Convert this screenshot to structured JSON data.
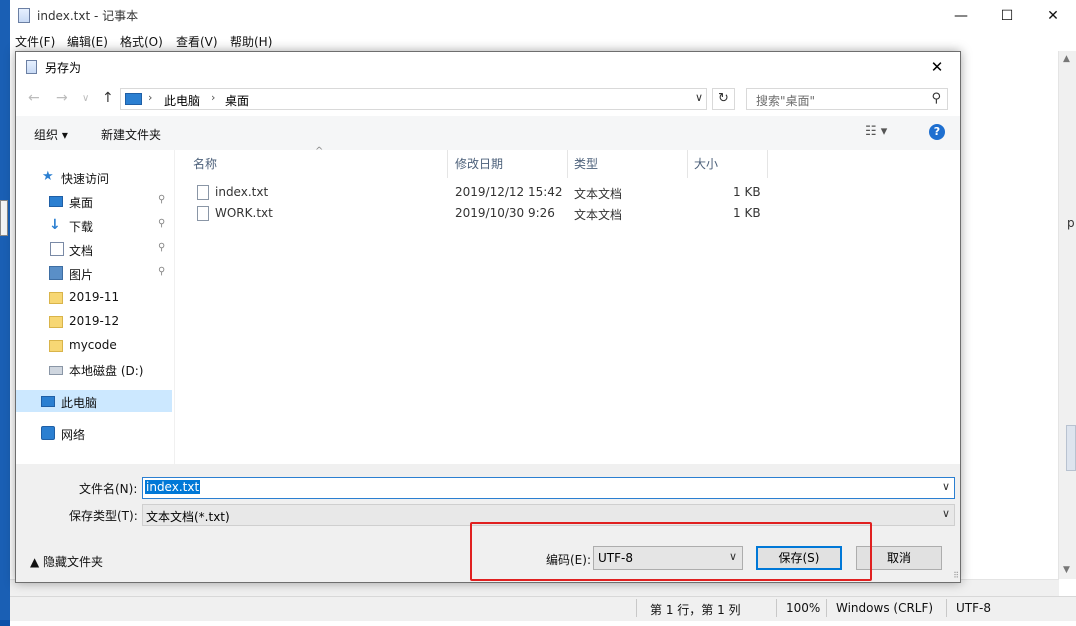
{
  "notepad": {
    "title": "index.txt - 记事本",
    "controls": {
      "minimize": "—",
      "maximize": "☐",
      "close": "✕"
    },
    "menu": [
      "文件(F)",
      "编辑(E)",
      "格式(O)",
      "查看(V)",
      "帮助(H)"
    ],
    "status": {
      "position": "第 1 行，第 1 列",
      "zoom": "100%",
      "line_ending": "Windows (CRLF)",
      "encoding": "UTF-8"
    },
    "peek_text": "p"
  },
  "dialog": {
    "title": "另存为",
    "close": "✕",
    "nav": {
      "back": "←",
      "forward": "→",
      "recent": "∨",
      "up": "↑"
    },
    "breadcrumb": [
      "此电脑",
      "桌面"
    ],
    "breadcrumb_sep": "›",
    "refresh": "↻",
    "search_placeholder": "搜索\"桌面\"",
    "toolbar": {
      "organize": "组织 ▾",
      "new_folder": "新建文件夹",
      "view": "☷ ▾",
      "help": "?"
    },
    "sidebar": [
      {
        "label": "快速访问",
        "icon": "star-icon"
      },
      {
        "label": "桌面",
        "icon": "desktop-icon",
        "pin": "📌"
      },
      {
        "label": "下载",
        "icon": "download-icon",
        "pin": "📌"
      },
      {
        "label": "文档",
        "icon": "document-icon",
        "pin": "📌"
      },
      {
        "label": "图片",
        "icon": "picture-icon",
        "pin": "📌"
      },
      {
        "label": "2019-11",
        "icon": "folder-icon"
      },
      {
        "label": "2019-12",
        "icon": "folder-icon"
      },
      {
        "label": "mycode",
        "icon": "folder-icon"
      },
      {
        "label": "本地磁盘 (D:)",
        "icon": "drive-icon"
      },
      {
        "label": "此电脑",
        "icon": "computer-icon",
        "selected": true
      },
      {
        "label": "网络",
        "icon": "network-icon"
      }
    ],
    "columns": [
      "名称",
      "修改日期",
      "类型",
      "大小"
    ],
    "sort_indicator": "^",
    "files": [
      {
        "name": "index.txt",
        "date": "2019/12/12 15:42",
        "type": "文本文档",
        "size": "1 KB"
      },
      {
        "name": "WORK.txt",
        "date": "2019/10/30 9:26",
        "type": "文本文档",
        "size": "1 KB"
      }
    ],
    "filename_label": "文件名(N):",
    "filename_value": "index.txt",
    "filetype_label": "保存类型(T):",
    "filetype_value": "文本文档(*.txt)",
    "hide_folders": "隐藏文件夹",
    "encoding_label": "编码(E):",
    "encoding_value": "UTF-8",
    "save_button": "保存(S)",
    "cancel_button": "取消",
    "dropdown_glyph": "∨"
  },
  "colors": {
    "accent": "#0078d7",
    "highlight_box": "#e02020",
    "selected_nav": "#cce8ff"
  }
}
